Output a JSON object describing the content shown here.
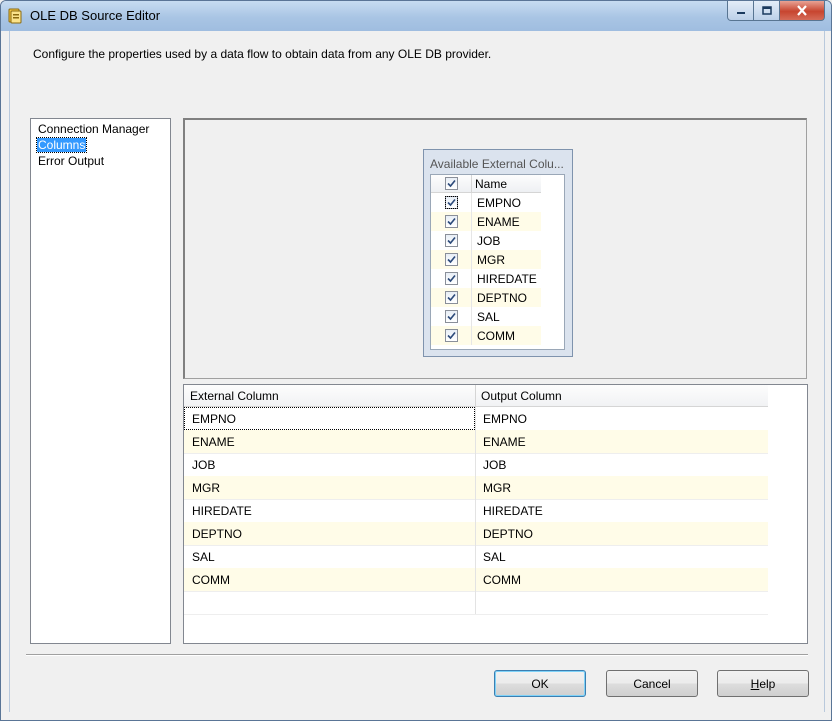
{
  "window": {
    "title": "OLE DB Source Editor",
    "description": "Configure the properties used by a data flow to obtain data from any OLE DB provider."
  },
  "nav": {
    "items": [
      {
        "label": "Connection Manager",
        "selected": false
      },
      {
        "label": "Columns",
        "selected": true
      },
      {
        "label": "Error Output",
        "selected": false
      }
    ]
  },
  "external_columns": {
    "title": "Available External Colu...",
    "header": "Name",
    "items": [
      {
        "name": "EMPNO",
        "checked": true
      },
      {
        "name": "ENAME",
        "checked": true
      },
      {
        "name": "JOB",
        "checked": true
      },
      {
        "name": "MGR",
        "checked": true
      },
      {
        "name": "HIREDATE",
        "checked": true
      },
      {
        "name": "DEPTNO",
        "checked": true
      },
      {
        "name": "SAL",
        "checked": true
      },
      {
        "name": "COMM",
        "checked": true
      }
    ]
  },
  "mapping_grid": {
    "headers": [
      "External Column",
      "Output Column"
    ],
    "rows": [
      [
        "EMPNO",
        "EMPNO"
      ],
      [
        "ENAME",
        "ENAME"
      ],
      [
        "JOB",
        "JOB"
      ],
      [
        "MGR",
        "MGR"
      ],
      [
        "HIREDATE",
        "HIREDATE"
      ],
      [
        "DEPTNO",
        "DEPTNO"
      ],
      [
        "SAL",
        "SAL"
      ],
      [
        "COMM",
        "COMM"
      ]
    ]
  },
  "buttons": {
    "ok": "OK",
    "cancel": "Cancel",
    "help": "Help"
  },
  "colors": {
    "selection": "#3399ff",
    "alt_row": "#fffce8",
    "titlebar": "#a9c5e4",
    "close_button": "#c7452f"
  }
}
